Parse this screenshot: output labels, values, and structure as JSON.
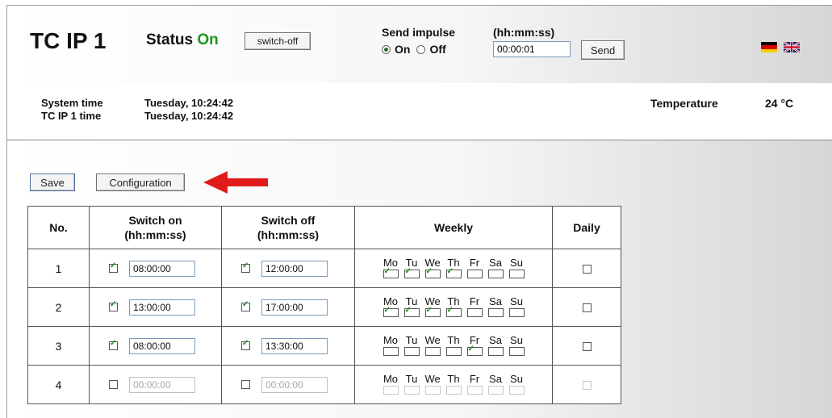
{
  "header": {
    "title": "TC IP 1",
    "status_label": "Status",
    "status_value": "On",
    "switch_off_label": "switch-off",
    "impulse_title": "Send impulse",
    "time_format": "(hh:mm:ss)",
    "radio_on": "On",
    "radio_off": "Off",
    "impulse_value": "00:00:01",
    "send_label": "Send"
  },
  "info": {
    "system_time_label": "System time",
    "system_time_value": "Tuesday, 10:24:42",
    "device_time_label": "TC IP 1 time",
    "device_time_value": "Tuesday, 10:24:42",
    "temperature_label": "Temperature",
    "temperature_value": "24 °C"
  },
  "actions": {
    "save_label": "Save",
    "configuration_label": "Configuration"
  },
  "table": {
    "headers": {
      "no": "No.",
      "switch_on": "Switch on",
      "switch_off": "Switch off",
      "time_fmt": "(hh:mm:ss)",
      "weekly": "Weekly",
      "daily": "Daily"
    },
    "days": [
      "Mo",
      "Tu",
      "We",
      "Th",
      "Fr",
      "Sa",
      "Su"
    ],
    "rows": [
      {
        "no": "1",
        "on_checked": true,
        "on_time": "08:00:00",
        "off_checked": true,
        "off_time": "12:00:00",
        "week": [
          true,
          true,
          true,
          true,
          false,
          false,
          false
        ],
        "daily": false,
        "enabled": true
      },
      {
        "no": "2",
        "on_checked": true,
        "on_time": "13:00:00",
        "off_checked": true,
        "off_time": "17:00:00",
        "week": [
          true,
          true,
          true,
          true,
          false,
          false,
          false
        ],
        "daily": false,
        "enabled": true
      },
      {
        "no": "3",
        "on_checked": true,
        "on_time": "08:00:00",
        "off_checked": true,
        "off_time": "13:30:00",
        "week": [
          false,
          false,
          false,
          false,
          true,
          false,
          false
        ],
        "daily": false,
        "enabled": true
      },
      {
        "no": "4",
        "on_checked": false,
        "on_time": "00:00:00",
        "off_checked": false,
        "off_time": "00:00:00",
        "week": [
          false,
          false,
          false,
          false,
          false,
          false,
          false
        ],
        "daily": false,
        "enabled": false
      }
    ]
  },
  "colors": {
    "status_on": "#1a9a1a",
    "arrow": "#e01b1b"
  },
  "icons": {
    "flag_de": "german-flag-icon",
    "flag_uk": "uk-flag-icon",
    "arrow": "arrow-left-icon"
  }
}
